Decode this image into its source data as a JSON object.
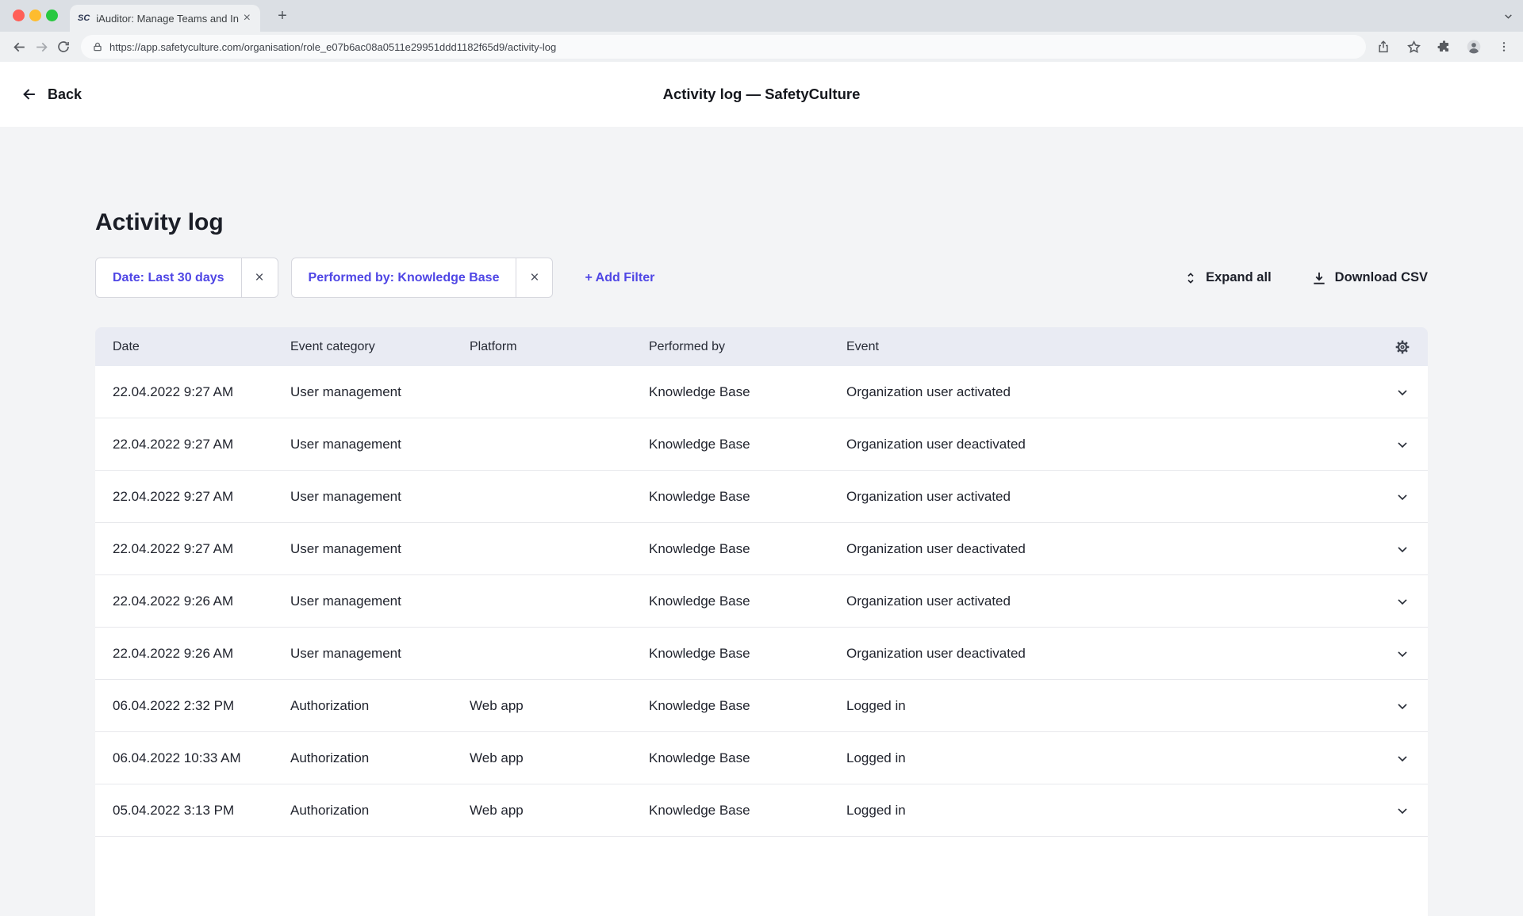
{
  "browser": {
    "tab_title": "iAuditor: Manage Teams and In",
    "url": "https://app.safetyculture.com/organisation/role_e07b6ac08a0511e29951ddd1182f65d9/activity-log",
    "favicon_text": "SC"
  },
  "icons": {
    "close_glyph": "×",
    "new_tab_glyph": "+"
  },
  "app_header": {
    "back_label": "Back",
    "title": "Activity log — SafetyCulture"
  },
  "page": {
    "title": "Activity log",
    "filters": [
      {
        "label": "Date: Last 30 days"
      },
      {
        "label": "Performed by: Knowledge Base"
      }
    ],
    "add_filter_label": "+ Add Filter",
    "expand_all_label": "Expand all",
    "download_csv_label": "Download CSV"
  },
  "table": {
    "columns": [
      "Date",
      "Event category",
      "Platform",
      "Performed by",
      "Event"
    ],
    "rows": [
      {
        "date": "22.04.2022 9:27 AM",
        "category": "User management",
        "platform": "",
        "performed_by": "Knowledge Base",
        "event": "Organization user activated"
      },
      {
        "date": "22.04.2022 9:27 AM",
        "category": "User management",
        "platform": "",
        "performed_by": "Knowledge Base",
        "event": "Organization user deactivated"
      },
      {
        "date": "22.04.2022 9:27 AM",
        "category": "User management",
        "platform": "",
        "performed_by": "Knowledge Base",
        "event": "Organization user activated"
      },
      {
        "date": "22.04.2022 9:27 AM",
        "category": "User management",
        "platform": "",
        "performed_by": "Knowledge Base",
        "event": "Organization user deactivated"
      },
      {
        "date": "22.04.2022 9:26 AM",
        "category": "User management",
        "platform": "",
        "performed_by": "Knowledge Base",
        "event": "Organization user activated"
      },
      {
        "date": "22.04.2022 9:26 AM",
        "category": "User management",
        "platform": "",
        "performed_by": "Knowledge Base",
        "event": "Organization user deactivated"
      },
      {
        "date": "06.04.2022 2:32 PM",
        "category": "Authorization",
        "platform": "Web app",
        "performed_by": "Knowledge Base",
        "event": "Logged in"
      },
      {
        "date": "06.04.2022 10:33 AM",
        "category": "Authorization",
        "platform": "Web app",
        "performed_by": "Knowledge Base",
        "event": "Logged in"
      },
      {
        "date": "05.04.2022 3:13 PM",
        "category": "Authorization",
        "platform": "Web app",
        "performed_by": "Knowledge Base",
        "event": "Logged in"
      }
    ]
  },
  "colors": {
    "accent": "#4f46e5",
    "table_header_bg": "#e9ebf3",
    "page_bg": "#f3f4f6",
    "header_bg": "#ffffff"
  }
}
